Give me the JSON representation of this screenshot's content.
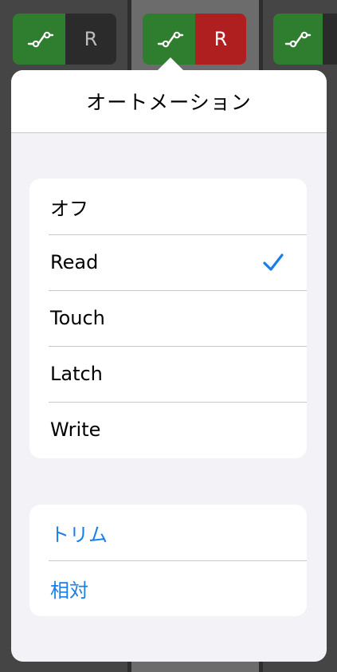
{
  "background_tracks": {
    "track1": {
      "mode_label": "R",
      "mode_color": "#2b2b2b"
    },
    "track2": {
      "mode_label": "R",
      "mode_color": "#b01f1f"
    },
    "track3": {
      "mode_label": ""
    }
  },
  "popover": {
    "title": "オートメーション",
    "modes": [
      {
        "label": "オフ",
        "selected": false
      },
      {
        "label": "Read",
        "selected": true
      },
      {
        "label": "Touch",
        "selected": false
      },
      {
        "label": "Latch",
        "selected": false
      },
      {
        "label": "Write",
        "selected": false
      }
    ],
    "actions": [
      {
        "label": "トリム"
      },
      {
        "label": "相対"
      }
    ]
  },
  "colors": {
    "automation_green": "#2f7d2f",
    "accent_blue": "#1a7ee8",
    "read_red": "#b01f1f"
  },
  "icons": {
    "automation": "automation-curve-icon",
    "selected": "checkmark-icon"
  }
}
